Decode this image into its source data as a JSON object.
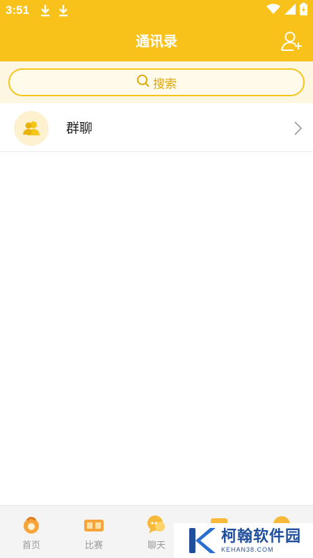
{
  "status_bar": {
    "time": "3:51"
  },
  "header": {
    "title": "通讯录"
  },
  "search": {
    "label": "搜索"
  },
  "contacts": [
    {
      "label": "群聊"
    }
  ],
  "tabbar": {
    "tabs": [
      {
        "label": "首页"
      },
      {
        "label": "比赛"
      },
      {
        "label": "聊天"
      },
      {
        "label": ""
      },
      {
        "label": ""
      }
    ]
  },
  "watermark": {
    "name": "柯翰软件园",
    "url": "KEHAN38.COM"
  },
  "colors": {
    "primary": "#f9c21a",
    "search_bg": "#fdf6e1",
    "watermark_blue": "#1f4f9c"
  }
}
